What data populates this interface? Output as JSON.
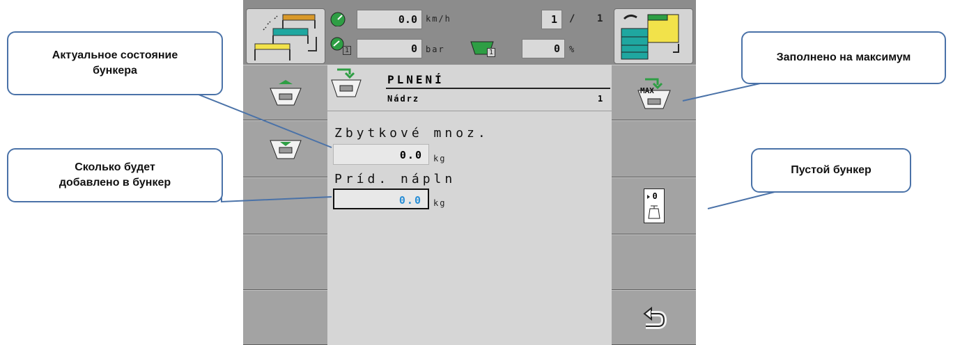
{
  "header": {
    "speed_value": "0.0",
    "speed_unit": "km/h",
    "page_current": "1",
    "page_separator": "/",
    "page_total": "1",
    "pressure_value": "0",
    "pressure_unit": "bar",
    "fill_percent_value": "0",
    "fill_percent_unit": "%",
    "sub_index": "1"
  },
  "panel": {
    "title": "PLNENÍ",
    "tank_label": "Nádrz",
    "tank_number": "1",
    "remaining_label": "Zbytkové mnoz.",
    "remaining_value": "0.0",
    "remaining_unit": "kg",
    "added_label": "Príd. nápln",
    "added_value": "0.0",
    "added_unit": "kg"
  },
  "softkeys": {
    "max_label": "MAX",
    "empty_label": "0"
  },
  "callouts": {
    "actual_state": "Актуальное состояние бункера",
    "to_add": "Сколько будет добавлено в бункер",
    "fill_max": "Заполнено на максимум",
    "empty": "Пустой бункер"
  },
  "colors": {
    "accent_blue": "#2a8fd6",
    "icon_green": "#2e9e44",
    "icon_yellow": "#f2e24a",
    "icon_teal": "#1fa7a0",
    "callout_border": "#4a72a8"
  }
}
